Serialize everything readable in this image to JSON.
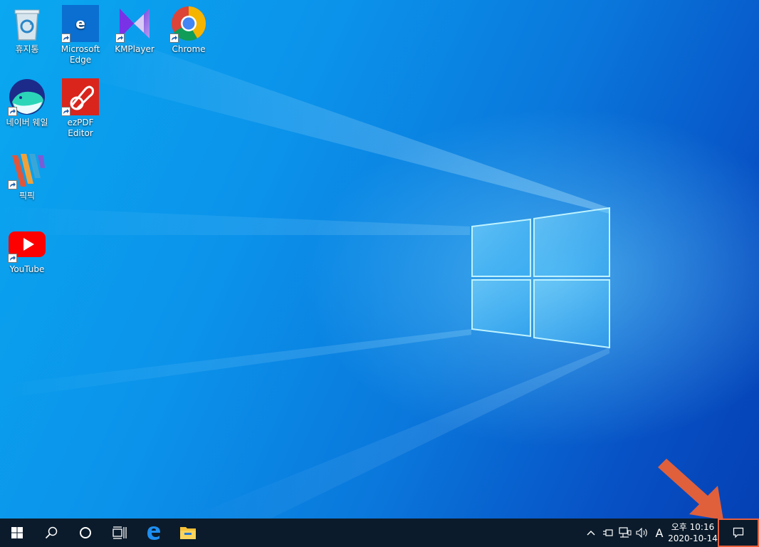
{
  "desktop": {
    "icons": [
      {
        "label": "휴지통",
        "icon": "recycle-bin-icon"
      },
      {
        "label": "Microsoft\nEdge",
        "icon": "edge-icon"
      },
      {
        "label": "KMPlayer",
        "icon": "kmplayer-icon"
      },
      {
        "label": "Chrome",
        "icon": "chrome-icon"
      },
      {
        "label": "네이버 웨일",
        "icon": "naver-whale-icon"
      },
      {
        "label": "ezPDF Editor",
        "icon": "ezpdf-icon"
      },
      {
        "label": "픽픽",
        "icon": "picpick-icon"
      },
      {
        "label": "YouTube",
        "icon": "youtube-icon"
      }
    ]
  },
  "taskbar": {
    "buttons": [
      "start-icon",
      "search-icon",
      "cortana-icon",
      "task-view-icon",
      "edge-icon",
      "file-explorer-icon"
    ],
    "tray": {
      "ime": "A",
      "time": "오후 10:16",
      "date": "2020-10-14"
    }
  },
  "colors": {
    "taskbar": "#0b1b2b",
    "highlight": "#e8603c"
  }
}
